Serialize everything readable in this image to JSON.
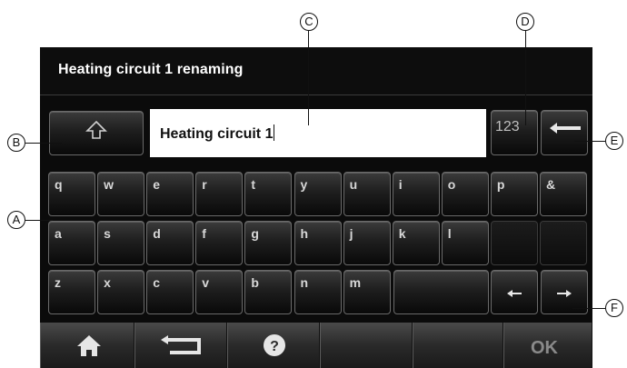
{
  "header": {
    "title": "Heating circuit 1 renaming"
  },
  "input": {
    "value": "Heating circuit 1"
  },
  "keyboard": {
    "mode_label": "123",
    "row1": [
      "q",
      "w",
      "e",
      "r",
      "t",
      "y",
      "u",
      "i",
      "o",
      "p",
      "&"
    ],
    "row2": [
      "a",
      "s",
      "d",
      "f",
      "g",
      "h",
      "j",
      "k",
      "l",
      "",
      ""
    ],
    "row3": [
      "z",
      "x",
      "c",
      "v",
      "b",
      "n",
      "m"
    ]
  },
  "nav": {
    "ok_label": "OK"
  },
  "callouts": {
    "A": "A",
    "B": "B",
    "C": "C",
    "D": "D",
    "E": "E",
    "F": "F"
  },
  "colors": {
    "screen_bg": "#0b0b0b",
    "key_border": "#6a6a6a",
    "text": "#ffffff"
  }
}
